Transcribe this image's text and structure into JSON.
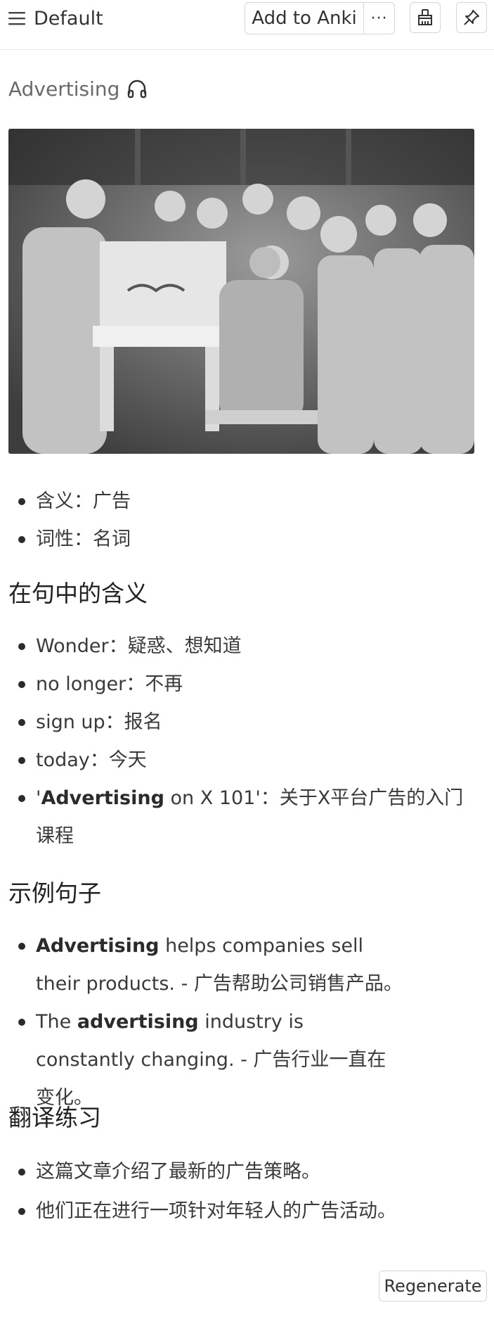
{
  "toolbar": {
    "deck_name": "Default",
    "add_label": "Add to Anki",
    "more_label": "···",
    "broom_icon": "broom-icon",
    "pin_icon": "pin-icon",
    "menu_icon": "hamburger-menu-icon"
  },
  "word": {
    "term": "Advertising",
    "audio_icon": "headphones-icon"
  },
  "image": {
    "kind": "black-and-white photograph"
  },
  "basic": {
    "items": [
      "含义：广告",
      "词性：名词"
    ]
  },
  "context": {
    "title": "在句中的含义",
    "items": [
      {
        "pre": "",
        "bold": "",
        "post": "Wonder：疑惑、想知道"
      },
      {
        "pre": "",
        "bold": "",
        "post": "no longer：不再"
      },
      {
        "pre": "",
        "bold": "",
        "post": "sign up：报名"
      },
      {
        "pre": "",
        "bold": "",
        "post": "today：今天"
      },
      {
        "pre": "'",
        "bold": "Advertising",
        "post": " on X 101'：关于X平台广告的入门课程"
      }
    ]
  },
  "examples": {
    "title": "示例句子",
    "items": [
      {
        "pre": "",
        "bold": "Advertising",
        "post": " helps companies sell their products. - 广告帮助公司销售产品。"
      },
      {
        "pre": "The ",
        "bold": "advertising",
        "post": " industry is constantly changing. - 广告行业一直在变化。"
      }
    ]
  },
  "practice": {
    "title": "翻译练习",
    "items": [
      "这篇文章介绍了最新的广告策略。",
      "他们正在进行一项针对年轻人的广告活动。"
    ]
  },
  "footer": {
    "regenerate_label": "Regenerate"
  },
  "colors": {
    "text": "#2b2b2b",
    "muted": "#6a6a6a",
    "border": "#d6d6d6"
  }
}
